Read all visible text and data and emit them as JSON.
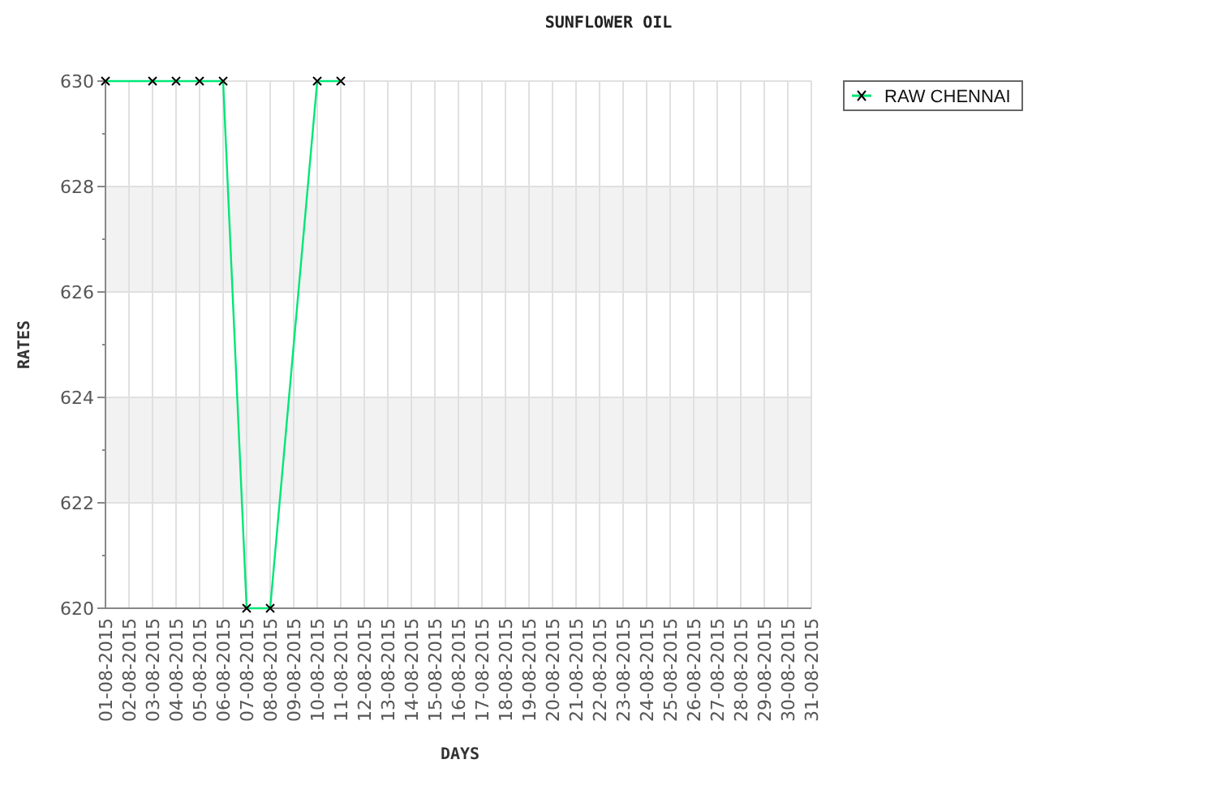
{
  "chart_data": {
    "type": "line",
    "title": "SUNFLOWER OIL",
    "xlabel": "DAYS",
    "ylabel": "RATES",
    "categories": [
      "01-08-2015",
      "02-08-2015",
      "03-08-2015",
      "04-08-2015",
      "05-08-2015",
      "06-08-2015",
      "07-08-2015",
      "08-08-2015",
      "09-08-2015",
      "10-08-2015",
      "11-08-2015",
      "12-08-2015",
      "13-08-2015",
      "14-08-2015",
      "15-08-2015",
      "16-08-2015",
      "17-08-2015",
      "18-08-2015",
      "19-08-2015",
      "20-08-2015",
      "21-08-2015",
      "22-08-2015",
      "23-08-2015",
      "24-08-2015",
      "25-08-2015",
      "26-08-2015",
      "27-08-2015",
      "28-08-2015",
      "29-08-2015",
      "30-08-2015",
      "31-08-2015"
    ],
    "grid": true,
    "series": [
      {
        "name": "RAW CHENNAI",
        "color": "#00e676",
        "marker": "x",
        "values": [
          630,
          null,
          630,
          630,
          630,
          630,
          620,
          620,
          null,
          630,
          630,
          null,
          null,
          null,
          null,
          null,
          null,
          null,
          null,
          null,
          null,
          null,
          null,
          null,
          null,
          null,
          null,
          null,
          null,
          null,
          null
        ]
      }
    ],
    "ylim": [
      620,
      630
    ],
    "yticks": [
      620,
      622,
      624,
      626,
      628,
      630
    ]
  }
}
